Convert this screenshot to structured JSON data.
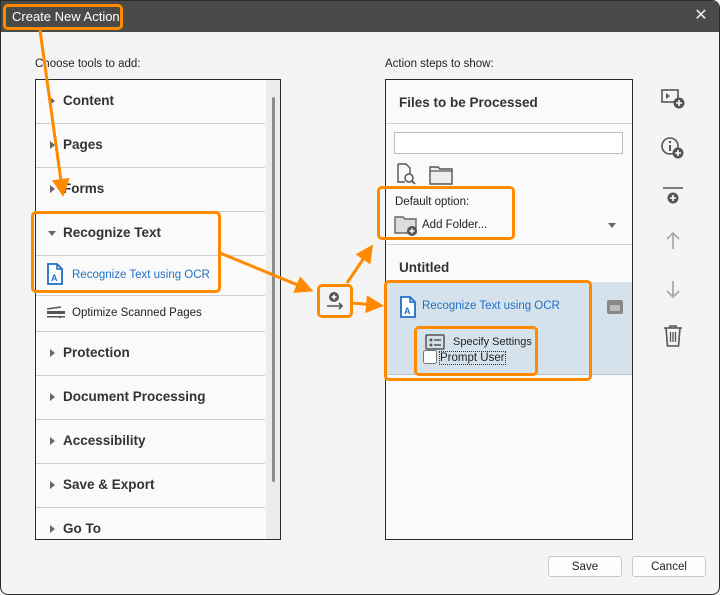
{
  "window": {
    "title": "Create New Action",
    "close_icon": "close-icon"
  },
  "left": {
    "label": "Choose tools to add:",
    "categories": [
      {
        "label": "Content",
        "expanded": false
      },
      {
        "label": "Pages",
        "expanded": false
      },
      {
        "label": "Forms",
        "expanded": false
      },
      {
        "label": "Recognize Text",
        "expanded": true
      },
      {
        "label": "Protection",
        "expanded": false
      },
      {
        "label": "Document Processing",
        "expanded": false
      },
      {
        "label": "Accessibility",
        "expanded": false
      },
      {
        "label": "Save & Export",
        "expanded": false
      },
      {
        "label": "Go To",
        "expanded": false
      }
    ],
    "tools": [
      {
        "label": "Recognize Text using OCR",
        "icon": "ocr-document-icon"
      },
      {
        "label": "Optimize Scanned Pages",
        "icon": "scanner-icon"
      }
    ]
  },
  "middle": {
    "add_button_icon": "add-to-action-icon"
  },
  "right": {
    "label": "Action steps to show:",
    "files_title": "Files to be Processed",
    "files_input_value": "",
    "default_option_label": "Default option:",
    "default_option_value": "Add Folder...",
    "group_title": "Untitled",
    "step": {
      "label": "Recognize Text using OCR",
      "specify_settings": "Specify Settings",
      "prompt_user": "Prompt User",
      "prompt_user_checked": false
    }
  },
  "side_tools": [
    {
      "name": "add-instruction-step",
      "icon": "instruction-add-icon"
    },
    {
      "name": "add-info",
      "icon": "info-add-icon"
    },
    {
      "name": "add-panel-separator",
      "icon": "separator-add-icon"
    },
    {
      "name": "move-up",
      "icon": "arrow-up-icon",
      "enabled": false
    },
    {
      "name": "move-down",
      "icon": "arrow-down-icon",
      "enabled": false
    },
    {
      "name": "delete",
      "icon": "trash-icon"
    }
  ],
  "footer": {
    "save_label": "Save",
    "cancel_label": "Cancel"
  },
  "colors": {
    "highlight": "#ff8a00",
    "link_blue": "#1f6fc5",
    "titlebar": "#4a4a48",
    "step_bg": "#d5e2ec"
  }
}
